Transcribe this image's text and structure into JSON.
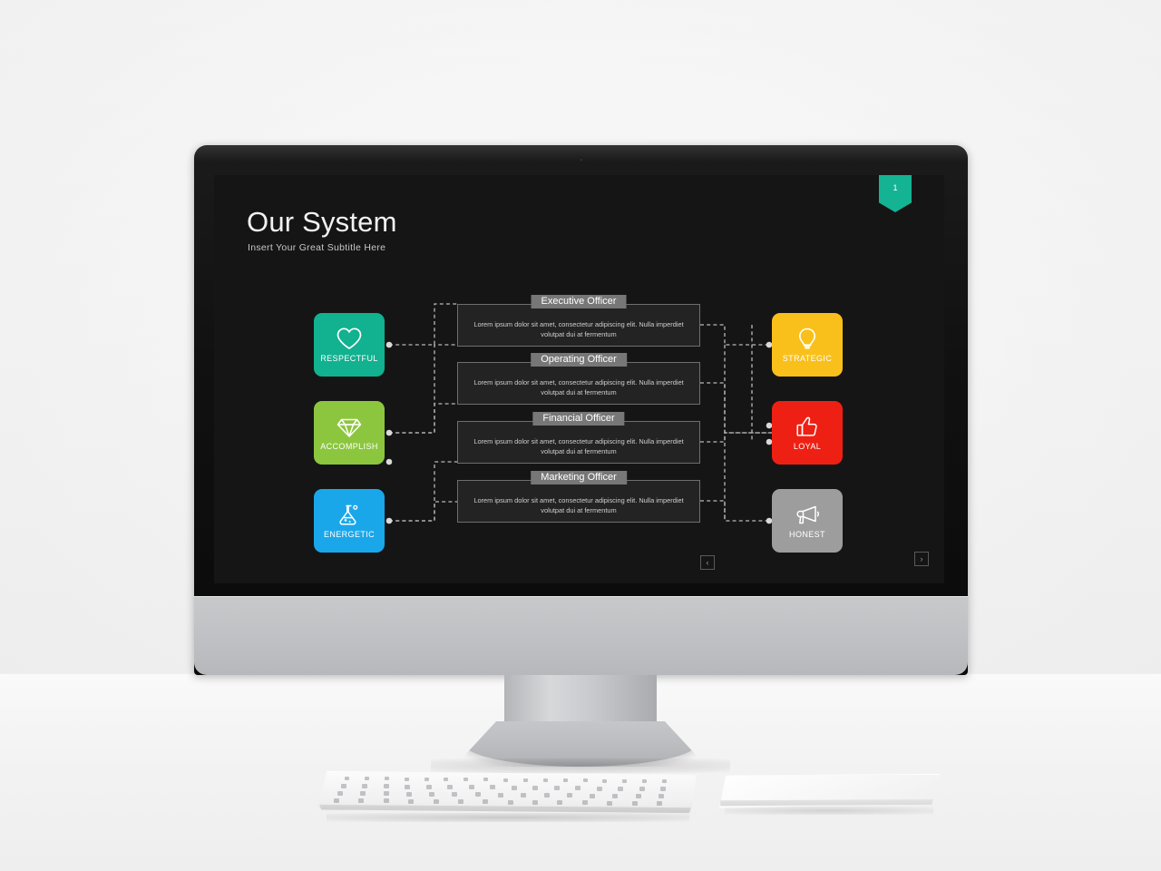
{
  "slide": {
    "title": "Our System",
    "subtitle": "Insert Your Great Subtitle Here",
    "page_badge": "1",
    "background_color": "#151515"
  },
  "left_tiles": [
    {
      "label": "RESPECTFUL",
      "icon": "heart-icon",
      "color": "#12b190"
    },
    {
      "label": "ACCOMPLISH",
      "icon": "diamond-icon",
      "color": "#8cc63e"
    },
    {
      "label": "ENERGETIC",
      "icon": "flask-icon",
      "color": "#1aa7ea"
    }
  ],
  "right_tiles": [
    {
      "label": "STRATEGIC",
      "icon": "lightbulb-icon",
      "color": "#f9c01b"
    },
    {
      "label": "LOYAL",
      "icon": "thumbs-up-icon",
      "color": "#ee2014"
    },
    {
      "label": "HONEST",
      "icon": "megaphone-icon",
      "color": "#9d9d9d"
    }
  ],
  "cards": [
    {
      "title": "Executive Officer",
      "body": "Lorem ipsum dolor sit amet, consectetur adipiscing elit. Nulla imperdiet volutpat dui at fermentum"
    },
    {
      "title": "Operating Officer",
      "body": "Lorem ipsum dolor sit amet, consectetur adipiscing elit. Nulla imperdiet volutpat dui at fermentum"
    },
    {
      "title": "Financial Officer",
      "body": "Lorem ipsum dolor sit amet, consectetur adipiscing elit. Nulla imperdiet volutpat dui at fermentum"
    },
    {
      "title": "Marketing Officer",
      "body": "Lorem ipsum dolor sit amet, consectetur adipiscing elit. Nulla imperdiet volutpat dui at fermentum"
    }
  ],
  "nav": {
    "prev_label": "‹",
    "next_label": "›"
  }
}
